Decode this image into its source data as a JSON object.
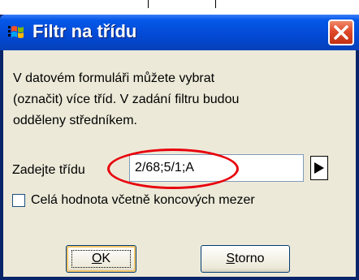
{
  "window": {
    "title": "Filtr na třídu"
  },
  "message": {
    "text": "V datovém formuláři můžete vybrat\n(označit) více tříd. V zadání filtru budou\nodděleny středníkem."
  },
  "field": {
    "label": "Zadejte třídu",
    "value": "2/68;5/1;A"
  },
  "checkbox": {
    "label": "Celá hodnota včetně koncových mezer",
    "checked": false
  },
  "buttons": {
    "ok_accel": "O",
    "ok_rest": "K",
    "storno_accel": "S",
    "storno_rest": "torno"
  },
  "colors": {
    "titlebar": "#0349d4",
    "close_button": "#e0492a",
    "dialog_background": "#ece9d8",
    "highlight_ring": "#e8000c"
  },
  "icons": {
    "app": "windows-flag-icon",
    "close": "close-icon",
    "play": "play-arrow-icon"
  }
}
